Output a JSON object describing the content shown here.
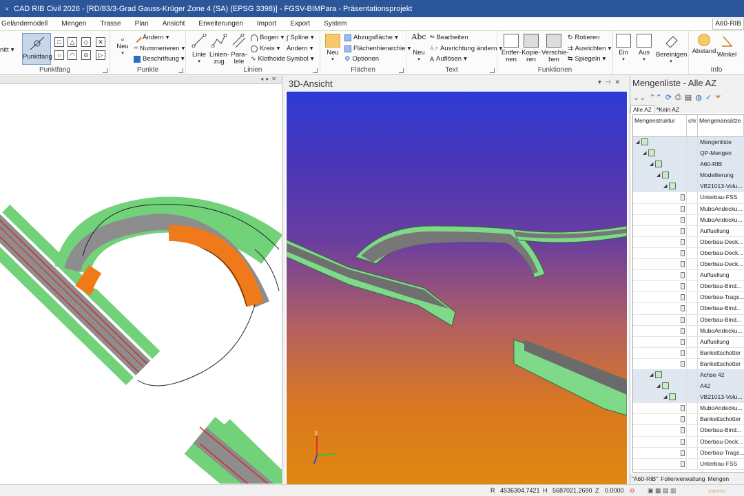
{
  "titlebar": {
    "quick_access": "˅",
    "title": "CAD RIB Civil 2026 - [RD/83/3-Grad Gauss-Krüger Zone 4 (SA) (EPSG 3398)] - FGSV-BIMPara - Präsentationsprojekt"
  },
  "menu": {
    "tabs": [
      "Geländemodell",
      "Mengen",
      "Trasse",
      "Plan",
      "Ansicht",
      "Erweiterungen",
      "Import",
      "Export",
      "System"
    ],
    "right_tag": "A60-RIB"
  },
  "ribbon": {
    "punktfang": {
      "left_partial": "nitt",
      "big": "Punktfang",
      "label": "Punktfang"
    },
    "punkte": {
      "neu": "Neu",
      "aendern": "Ändern",
      "nummerieren": "Nummerieren",
      "beschriftung": "Beschriftung",
      "label": "Punkte"
    },
    "linien": {
      "linie": "Linie",
      "linienzug": "Linien-\nzug",
      "parallele": "Para-\nlele",
      "bogen": "Bogen",
      "kreis": "Kreis",
      "klothoide": "Klothoide",
      "spline": "Spline",
      "aendern": "Ändern",
      "symbol": "Symbol",
      "label": "Linien"
    },
    "flaechen": {
      "neu": "Neu",
      "abzugsflaeche": "Abzugsfläche",
      "flaechenhierarchie": "Flächenhierarchie",
      "optionen": "Optionen",
      "label": "Flächen"
    },
    "text": {
      "abc": "Abc",
      "neu": "Neu",
      "bearbeiten": "Bearbeiten",
      "ausrichtung": "Ausrichtung ändern",
      "aufloesen": "Auflösen",
      "label": "Text"
    },
    "funktionen": {
      "entfernen": "Entfer-\nnen",
      "kopieren": "Kopie-\nren",
      "verschieben": "Verschie-\nben",
      "rotieren": "Rotieren",
      "ausrichten": "Ausrichten",
      "spiegeln": "Spiegeln",
      "label": "Funktionen"
    },
    "ansicht": {
      "ein": "Ein",
      "aus": "Aus",
      "bereinigen": "Bereinigen"
    },
    "info": {
      "abstand": "Abstand",
      "winkel": "Winkel",
      "label": "Info"
    }
  },
  "view3d": {
    "title": "3D-Ansicht",
    "axis_z": "z"
  },
  "mengen": {
    "title": "Mengenliste - Alle AZ",
    "subtabs": [
      "Alle AZ",
      "*Kein AZ"
    ],
    "columns": [
      "Mengenstruktur",
      "chr",
      "Mengenansätze"
    ],
    "rows": [
      {
        "text": "Mengenliste",
        "level": 0,
        "type": "group"
      },
      {
        "text": "QP-Mengen",
        "level": 1,
        "type": "group"
      },
      {
        "text": "A60-RIB",
        "level": 2,
        "type": "group"
      },
      {
        "text": "Modellierung",
        "level": 3,
        "type": "group"
      },
      {
        "text": "VB21013-Volu...",
        "level": 4,
        "type": "group"
      },
      {
        "text": "Unterbau-FSS",
        "type": "item"
      },
      {
        "text": "MuboAndecku...",
        "type": "item"
      },
      {
        "text": "MuboAndecku...",
        "type": "item"
      },
      {
        "text": "Auffuellung",
        "type": "item"
      },
      {
        "text": "Oberbau-Deck...",
        "type": "item"
      },
      {
        "text": "Oberbau-Deck...",
        "type": "item"
      },
      {
        "text": "Oberbau-Deck...",
        "type": "item"
      },
      {
        "text": "Auffuellung",
        "type": "item"
      },
      {
        "text": "Oberbau-Bind...",
        "type": "item"
      },
      {
        "text": "Oberbau-Trags...",
        "type": "item"
      },
      {
        "text": "Oberbau-Bind...",
        "type": "item"
      },
      {
        "text": "Oberbau-Bind...",
        "type": "item"
      },
      {
        "text": "MuboAndecku...",
        "type": "item"
      },
      {
        "text": "Auffuellung",
        "type": "item"
      },
      {
        "text": "Bankettschotter",
        "type": "item"
      },
      {
        "text": "Bankettschotter",
        "type": "item"
      },
      {
        "text": "Achse 42",
        "level": 2,
        "type": "group"
      },
      {
        "text": "A42",
        "level": 3,
        "type": "group"
      },
      {
        "text": "VB21013-Volu...",
        "level": 4,
        "type": "group"
      },
      {
        "text": "MuboAndecku...",
        "type": "item"
      },
      {
        "text": "Bankettschotter",
        "type": "item"
      },
      {
        "text": "Oberbau-Bind...",
        "type": "item"
      },
      {
        "text": "Oberbau-Deck...",
        "type": "item"
      },
      {
        "text": "Oberbau-Trags...",
        "type": "item"
      },
      {
        "text": "Unterbau-FSS",
        "type": "item"
      }
    ],
    "bottom_tabs": [
      "\"A60-RIB\"",
      "Folienverwaltung",
      "Mengen"
    ]
  },
  "status": {
    "r_label": "R",
    "r_value": "4536304.7421",
    "h_label": "H",
    "h_value": "5687021.2690",
    "z_label": "Z",
    "z_value": "0.0000"
  }
}
